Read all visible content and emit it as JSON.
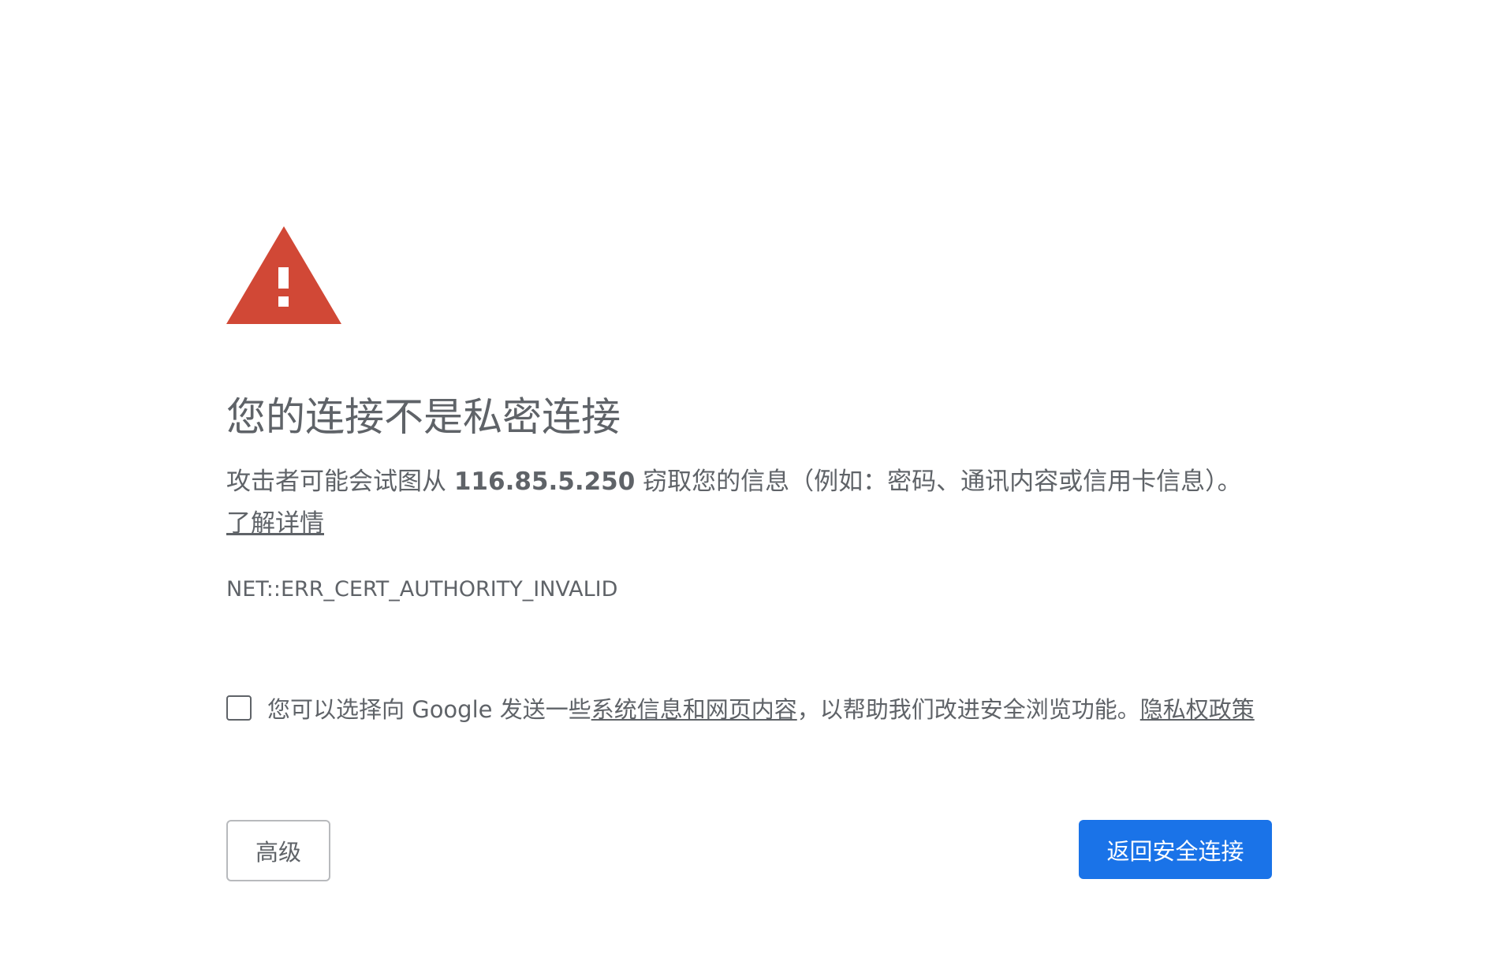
{
  "icon": {
    "name": "warning-triangle-icon",
    "color": "#d14836",
    "mark_color": "#ffffff"
  },
  "heading": "您的连接不是私密连接",
  "explanation": {
    "prefix": "攻击者可能会试图从 ",
    "host": "116.85.5.250",
    "suffix": " 窃取您的信息（例如：密码、通讯内容或信用卡信息）。",
    "learn_more": "了解详情"
  },
  "error_code": "NET::ERR_CERT_AUTHORITY_INVALID",
  "optin": {
    "text_before": "您可以选择向 Google 发送一些",
    "link_system_info": "系统信息和网页内容",
    "text_after": "，以帮助我们改进安全浏览功能。",
    "link_privacy": "隐私权政策"
  },
  "buttons": {
    "advanced": "高级",
    "back_to_safety": "返回安全连接"
  },
  "colors": {
    "text": "#5f6368",
    "primary_button": "#1a73e8",
    "secondary_border": "#b8babd"
  }
}
